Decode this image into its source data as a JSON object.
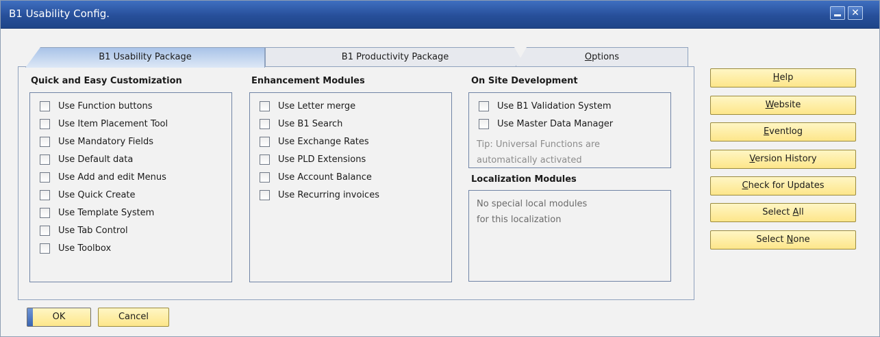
{
  "window": {
    "title": "B1 Usability Config.",
    "minimize_label": "",
    "close_label": "✕"
  },
  "tabs": [
    {
      "pre": "",
      "key": "",
      "post": "B1 Usability Package"
    },
    {
      "pre": "",
      "key": "",
      "post": "B1 Productivity Package"
    },
    {
      "pre": "",
      "key": "O",
      "post": "ptions"
    }
  ],
  "quick": {
    "title": "Quick and Easy Customization",
    "items": [
      "Use Function buttons",
      "Use Item Placement Tool",
      "Use Mandatory Fields",
      "Use Default data",
      "Use Add and edit Menus",
      "Use Quick Create",
      "Use Template System",
      "Use Tab Control",
      "Use Toolbox"
    ]
  },
  "enhancement": {
    "title": "Enhancement Modules",
    "items": [
      "Use Letter merge",
      "Use B1 Search",
      "Use Exchange Rates",
      "Use PLD Extensions",
      "Use Account Balance",
      "Use Recurring invoices"
    ]
  },
  "onsite": {
    "title": "On Site Development",
    "items": [
      "Use B1 Validation System",
      "Use Master Data Manager"
    ],
    "tip_line1": "Tip: Universal Functions are",
    "tip_line2": "automatically activated"
  },
  "localization": {
    "title": "Localization Modules",
    "line1": "No special local modules",
    "line2": "for this localization"
  },
  "side_buttons": [
    {
      "pre": "",
      "key": "H",
      "post": "elp"
    },
    {
      "pre": "",
      "key": "W",
      "post": "ebsite"
    },
    {
      "pre": "",
      "key": "E",
      "post": "ventlog"
    },
    {
      "pre": "",
      "key": "V",
      "post": "ersion History"
    },
    {
      "pre": "",
      "key": "C",
      "post": "heck for Updates"
    },
    {
      "pre": "Select ",
      "key": "A",
      "post": "ll"
    },
    {
      "pre": "Select ",
      "key": "N",
      "post": "one"
    }
  ],
  "footer": {
    "ok_label": "OK",
    "cancel_label": "Cancel"
  },
  "colors": {
    "titlebar": "#274f9a",
    "active_tab": "#a9c3e8",
    "button_yellow": "#fde68a"
  }
}
